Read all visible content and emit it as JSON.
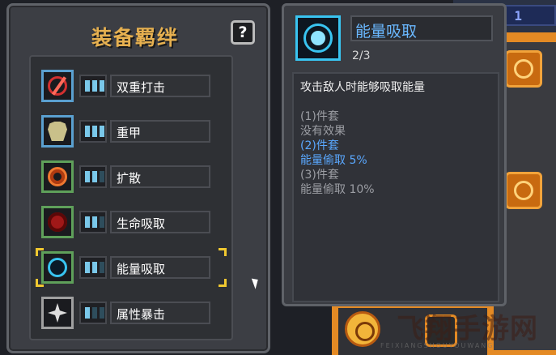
{
  "panel": {
    "title": "装备羁绊",
    "help_label": "?"
  },
  "bonds": [
    {
      "name": "双重打击",
      "icon": "double-strike-icon",
      "level": 3,
      "max_level": 3,
      "border_color": "#5aa0d0",
      "selected": false
    },
    {
      "name": "重甲",
      "icon": "heavy-armor-icon",
      "level": 3,
      "max_level": 3,
      "border_color": "#5aa0d0",
      "selected": false
    },
    {
      "name": "扩散",
      "icon": "spread-icon",
      "level": 2,
      "max_level": 3,
      "border_color": "#5fa05a",
      "selected": false
    },
    {
      "name": "生命吸取",
      "icon": "life-steal-icon",
      "level": 2,
      "max_level": 3,
      "border_color": "#5fa05a",
      "selected": false
    },
    {
      "name": "能量吸取",
      "icon": "energy-steal-icon",
      "level": 2,
      "max_level": 3,
      "border_color": "#5fa05a",
      "selected": true
    },
    {
      "name": "属性暴击",
      "icon": "attribute-crit-icon",
      "level": 1,
      "max_level": 3,
      "border_color": "#a0a0a0",
      "selected": false
    }
  ],
  "tooltip": {
    "title": "能量吸取",
    "level": "2/3",
    "description": "攻击敌人时能够吸取能量",
    "tiers": [
      {
        "header": "(1)件套",
        "effect": "没有效果",
        "active": false
      },
      {
        "header": "(2)件套",
        "effect": "能量偷取 5%",
        "active": true
      },
      {
        "header": "(3)件套",
        "effect": "能量偷取 10%",
        "active": false
      }
    ]
  },
  "background": {
    "top_right_badge": "1"
  },
  "watermark": {
    "text": "飞翔手游网",
    "subtext": "FEIXIANGSHOUYOUWANG"
  }
}
